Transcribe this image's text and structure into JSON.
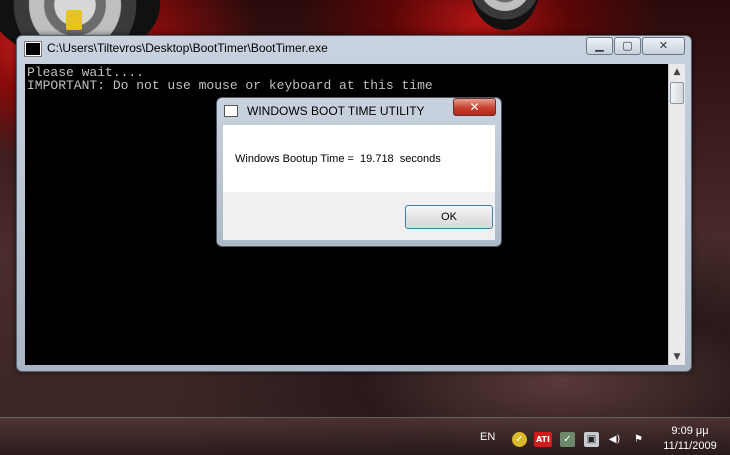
{
  "console_window": {
    "title": "C:\\Users\\Tiltevros\\Desktop\\BootTimer\\BootTimer.exe",
    "minimize_label": "▁",
    "maximize_label": "▢",
    "close_label": "✕",
    "lines": [
      "Please wait....",
      "IMPORTANT: Do not use mouse or keyboard at this time"
    ]
  },
  "dialog": {
    "title": "WINDOWS BOOT TIME UTILITY",
    "close_label": "✕",
    "message": "Windows Bootup Time =  19.718  seconds",
    "ok_label": "OK"
  },
  "taskbar": {
    "language": "EN",
    "tray_labels": {
      "ati": "ATI"
    },
    "time": "9:09 μμ",
    "date": "11/11/2009"
  },
  "icons": {
    "console_app": "console-app-icon",
    "dialog_app": "dialog-app-icon",
    "tray": [
      "norton-icon",
      "ati-icon",
      "safely-remove-icon",
      "network-icon",
      "volume-icon",
      "action-center-flag-icon"
    ]
  }
}
